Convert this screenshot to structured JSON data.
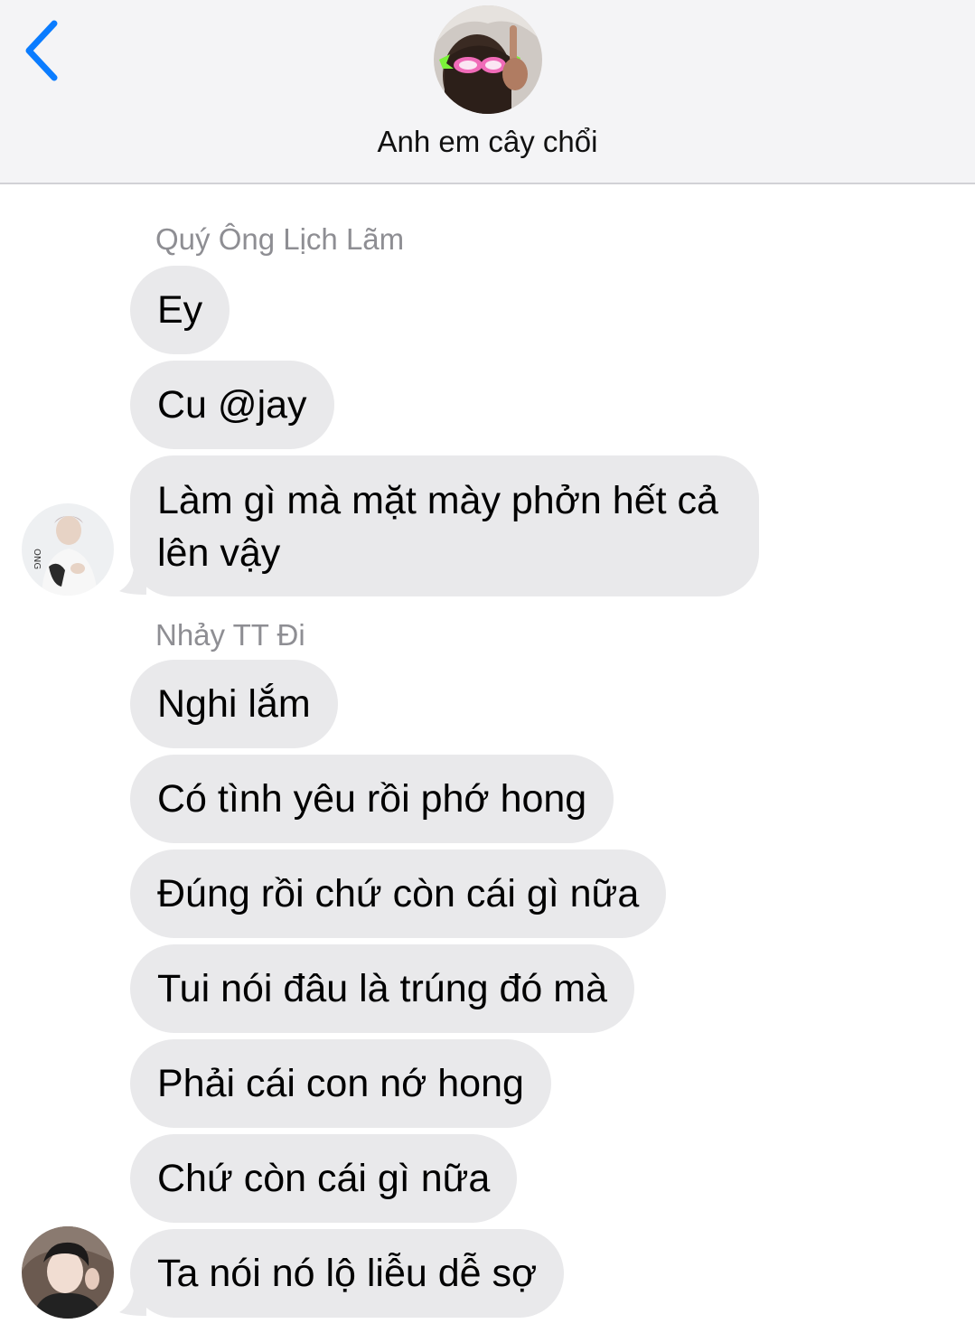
{
  "header": {
    "back_icon": "chevron-left-icon",
    "group_name": "Anh em cây chổi",
    "accent": "#0a7cff"
  },
  "messages": {
    "group1": {
      "sender": "Quý Ông Lịch Lãm",
      "m1": "Ey",
      "m2": "Cu @jay",
      "m3": "Làm gì mà mặt mày phởn hết cả lên vậy"
    },
    "group2": {
      "sender": "Nhảy TT Đi",
      "m1": "Nghi lắm",
      "m2": "Có tình yêu rồi phớ hong",
      "m3": "Đúng rồi chứ còn cái gì nữa",
      "m4": "Tui nói đâu là trúng đó mà",
      "m5": "Phải cái con nớ hong",
      "m6": "Chứ còn cái gì nữa",
      "m7": "Ta nói nó lộ liễu dễ sợ"
    }
  },
  "colors": {
    "incoming_bubble": "#e9e9eb",
    "sender_name": "#8e8e93",
    "header_bg": "#f4f4f6"
  }
}
